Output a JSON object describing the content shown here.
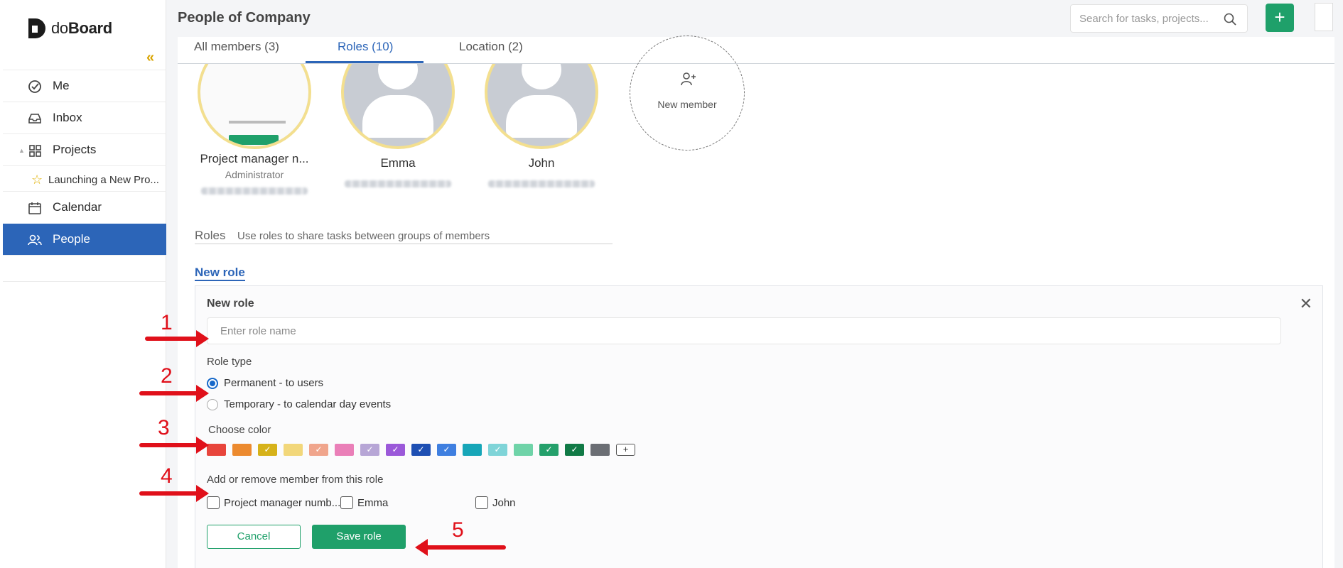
{
  "app": {
    "logo_text_light": "do",
    "logo_text_bold": "Board"
  },
  "sidebar": {
    "items": [
      {
        "label": "Me",
        "icon": "check-circle-icon"
      },
      {
        "label": "Inbox",
        "icon": "inbox-icon"
      },
      {
        "label": "Projects",
        "icon": "grid-icon"
      },
      {
        "label": "Launching a New Pro...",
        "icon": "star-icon"
      },
      {
        "label": "Calendar",
        "icon": "calendar-icon"
      },
      {
        "label": "People",
        "icon": "people-icon",
        "active": true
      }
    ]
  },
  "header": {
    "title": "People of Company",
    "search_placeholder": "Search for tasks, projects...",
    "add_label": "+"
  },
  "tabs": [
    {
      "label": "All members (3)"
    },
    {
      "label": "Roles (10)",
      "active": true
    },
    {
      "label": "Location (2)"
    }
  ],
  "members": [
    {
      "name": "Project manager n...",
      "role": "Administrator"
    },
    {
      "name": "Emma",
      "role": ""
    },
    {
      "name": "John",
      "role": ""
    }
  ],
  "new_member": {
    "label": "New member"
  },
  "roles_section": {
    "heading": "Roles",
    "description": "Use roles to share tasks between groups of members",
    "new_role_link": "New role"
  },
  "new_role_panel": {
    "title": "New role",
    "name_placeholder": "Enter role name",
    "role_type_label": "Role type",
    "role_types": [
      {
        "label": "Permanent - to users",
        "selected": true
      },
      {
        "label": "Temporary - to calendar day events",
        "selected": false
      }
    ],
    "choose_color_label": "Choose color",
    "colors": [
      "#e8453c",
      "#ec8a2f",
      "#d6b21a",
      "#f2d77a",
      "#f0a58c",
      "#ea7fb8",
      "#b7a6d6",
      "#9b59d9",
      "#1e4fb3",
      "#3f7fe0",
      "#17a6b8",
      "#7fd4d8",
      "#6fd3a8",
      "#24a06b",
      "#117a46",
      "#6b6e74"
    ],
    "color_checks": [
      false,
      false,
      true,
      false,
      true,
      false,
      true,
      true,
      true,
      true,
      false,
      true,
      false,
      true,
      true,
      false
    ],
    "add_color_label": "+",
    "members_label": "Add or remove member from this role",
    "member_options": [
      {
        "label": "Project manager numb..."
      },
      {
        "label": "Emma"
      },
      {
        "label": "John"
      }
    ],
    "cancel_label": "Cancel",
    "save_label": "Save role"
  },
  "annotations": [
    "1",
    "2",
    "3",
    "4",
    "5"
  ]
}
